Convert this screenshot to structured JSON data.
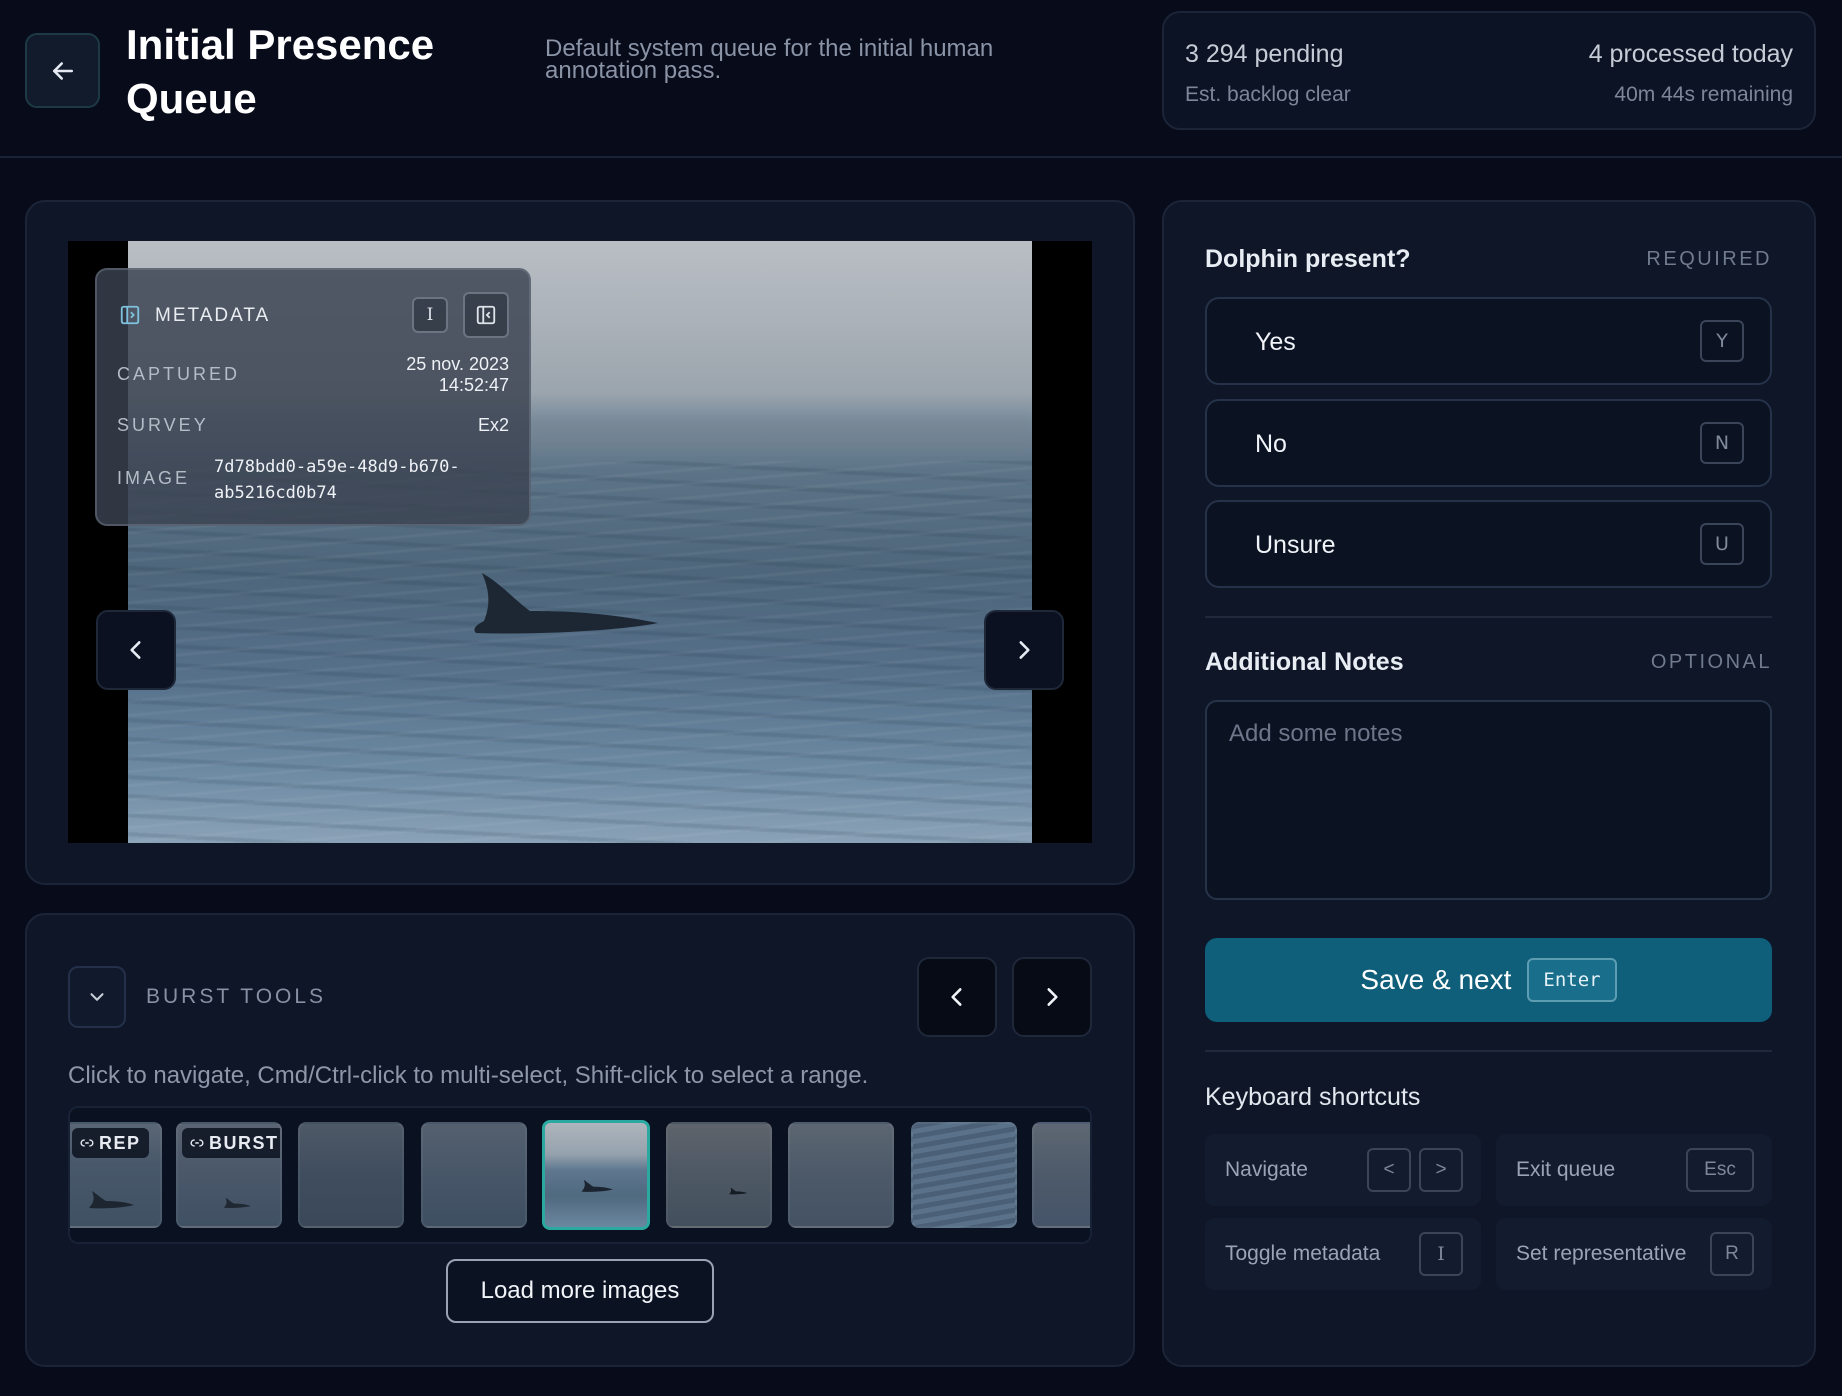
{
  "header": {
    "title": "Initial Presence Queue",
    "description": "Default system queue for the initial human annotation pass.",
    "stats": {
      "pending": "3 294 pending",
      "processed_today": "4 processed today",
      "backlog_label": "Est. backlog clear",
      "remaining": "40m 44s remaining"
    }
  },
  "metadata": {
    "heading": "METADATA",
    "toggle_key": "I",
    "rows": [
      {
        "key": "CAPTURED",
        "value_line1": "25 nov. 2023",
        "value_line2": "14:52:47"
      },
      {
        "key": "SURVEY",
        "value": "Ex2"
      },
      {
        "key": "IMAGE",
        "value_line1": "7d78bdd0-a59e-48d9-b670-",
        "value_line2": "ab5216cd0b74"
      }
    ]
  },
  "burst": {
    "label": "BURST TOOLS",
    "help": "Click to navigate, Cmd/Ctrl-click to multi-select, Shift-click to select a range.",
    "badges": {
      "rep": "REP",
      "burst": "BURST"
    },
    "load_more": "Load more images"
  },
  "question": {
    "title": "Dolphin present?",
    "tag": "REQUIRED",
    "options": [
      {
        "label": "Yes",
        "key": "Y"
      },
      {
        "label": "No",
        "key": "N"
      },
      {
        "label": "Unsure",
        "key": "U"
      }
    ]
  },
  "notes": {
    "title": "Additional Notes",
    "tag": "OPTIONAL",
    "placeholder": "Add some notes"
  },
  "save": {
    "label": "Save & next",
    "key": "Enter"
  },
  "shortcuts": {
    "title": "Keyboard shortcuts",
    "items": [
      {
        "label": "Navigate",
        "keys": [
          "<",
          ">"
        ]
      },
      {
        "label": "Exit queue",
        "keys": [
          "Esc"
        ]
      },
      {
        "label": "Toggle metadata",
        "keys": [
          "I"
        ]
      },
      {
        "label": "Set representative",
        "keys": [
          "R"
        ]
      }
    ]
  },
  "colors": {
    "accent": "#0f5e7a",
    "active_thumb": "#2aa9a0",
    "background": "#070b1a"
  }
}
